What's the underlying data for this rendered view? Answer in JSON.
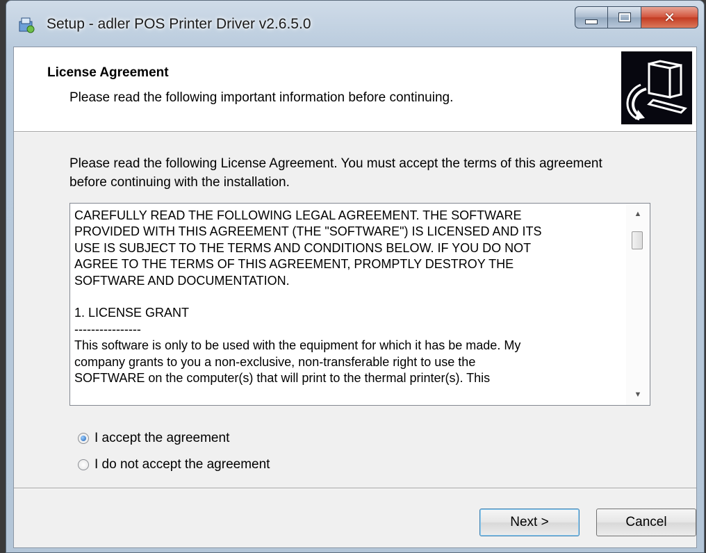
{
  "window": {
    "title": "Setup - adler POS Printer Driver v2.6.5.0",
    "icons": {
      "app": "setup-app-icon",
      "minimize": "minimize-icon",
      "maximize": "maximize-icon",
      "close": "close-icon"
    }
  },
  "header": {
    "title": "License Agreement",
    "subtitle": "Please read the following important information before continuing.",
    "image": "computer-install-icon"
  },
  "body": {
    "intro": "Please read the following License Agreement. You must accept the terms of this agreement before continuing with the installation.",
    "license_text": "CAREFULLY READ THE FOLLOWING LEGAL AGREEMENT. THE SOFTWARE\nPROVIDED WITH THIS AGREEMENT (THE \"SOFTWARE\") IS LICENSED AND ITS\nUSE IS SUBJECT TO THE TERMS AND CONDITIONS BELOW. IF YOU DO NOT\nAGREE TO THE TERMS OF THIS AGREEMENT, PROMPTLY DESTROY THE\nSOFTWARE AND DOCUMENTATION.\n\n1. LICENSE GRANT\n----------------\nThis software is only to be used with the equipment for which it has be made. My\ncompany grants to you a non-exclusive, non-transferable right to use the\nSOFTWARE on the computer(s) that will print to the thermal printer(s). This",
    "accept_option": "I accept the agreement",
    "decline_option": "I do not accept the agreement",
    "selected": "accept"
  },
  "footer": {
    "next_label": "Next >",
    "cancel_label": "Cancel"
  }
}
